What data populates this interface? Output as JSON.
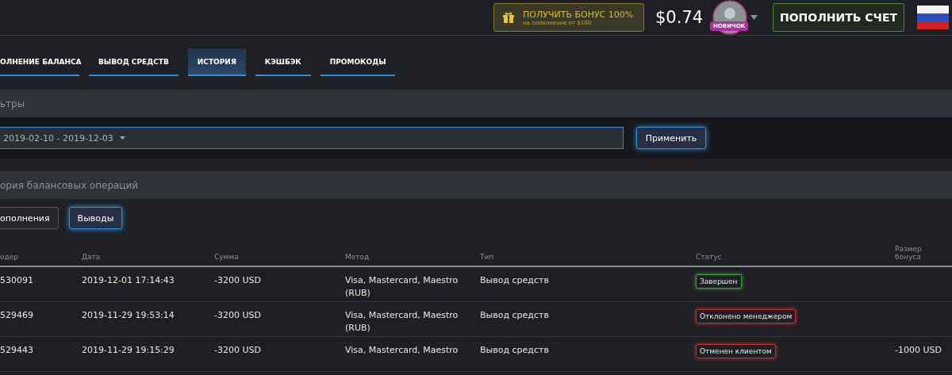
{
  "header": {
    "bonus": {
      "title": "ПОЛУЧИТЬ БОНУС 100%",
      "subtitle": "на пополнение от $100"
    },
    "balance": "$0.74",
    "user_badge": "НОВИЧОК",
    "deposit_button": "ПОПОЛНИТЬ СЧЕТ"
  },
  "tabs": [
    {
      "label": "ОЛНЕНИЕ БАЛАНСА",
      "selected": false
    },
    {
      "label": "ВЫВОД СРЕДСТВ",
      "selected": false
    },
    {
      "label": "ИСТОРИЯ",
      "selected": true
    },
    {
      "label": "КЭШБЭК",
      "selected": false
    },
    {
      "label": "ПРОМОКОДЫ",
      "selected": false
    }
  ],
  "filters": {
    "title": "ьтры",
    "date_range": "2019-02-10 - 2019-12-03",
    "apply_button": "Применить"
  },
  "history": {
    "title": "ория балансовых операций",
    "toggles": [
      {
        "label": "ополнения",
        "selected": false
      },
      {
        "label": "Выводы",
        "selected": true
      }
    ],
    "table": {
      "columns": [
        "одер",
        "Дата",
        "Сумма",
        "Метод",
        "Тип",
        "Статус",
        "Размер бонуса"
      ],
      "rows": [
        {
          "order": "530091",
          "date": "2019-12-01 17:14:43",
          "amount": "-3200 USD",
          "method": "Visa, Mastercard, Maestro (RUB)",
          "type": "Вывод средств",
          "status": {
            "label": "Завершен",
            "color": "#3fa33a"
          }
        },
        {
          "order": "529469",
          "date": "2019-11-29 19:53:14",
          "amount": "-3200 USD",
          "method": "Visa, Mastercard, Maestro (RUB)",
          "type": "Вывод средств",
          "status": {
            "label": "Отклонено менеджером",
            "color": "#c8302c"
          }
        },
        {
          "order": "529443",
          "date": "2019-11-29 19:15:29",
          "amount": "-3200 USD",
          "method": "Visa, Mastercard, Maestro",
          "type": "Вывод средств",
          "status": {
            "label": "Отменен клиентом",
            "color": "#c8302c"
          },
          "bonus": "-1000 USD"
        }
      ]
    }
  }
}
